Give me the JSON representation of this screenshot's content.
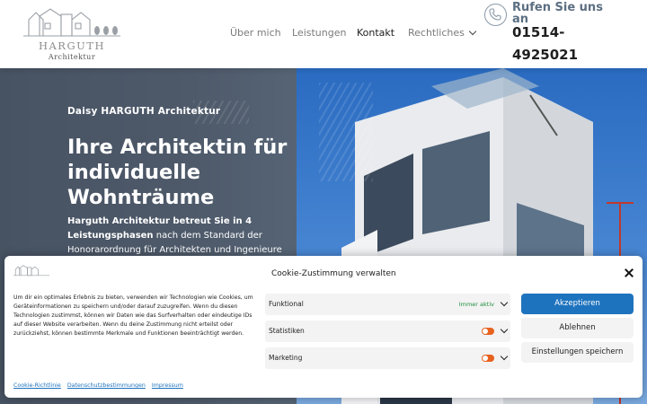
{
  "header": {
    "logo": {
      "name": "HARGUTH",
      "sub": "Architektur"
    },
    "nav": [
      {
        "label": "Über mich",
        "active": false
      },
      {
        "label": "Leistungen",
        "active": false
      },
      {
        "label": "Kontakt",
        "active": true
      },
      {
        "label": "Rechtliches",
        "active": false,
        "dropdown": true
      }
    ],
    "call": {
      "label": "Rufen Sie uns an",
      "number": "01514-4925021",
      "icon": "phone-icon"
    }
  },
  "hero": {
    "kicker": "Daisy HARGUTH Architektur",
    "title": "Ihre Architektin für individuelle Wohnträume",
    "text_bold": "Harguth Architektur betreut Sie in 4 Leistungsphasen",
    "text_rest": " nach dem Standard der Honorarordnung für Architekten und Ingenieure"
  },
  "cookie": {
    "title": "Cookie-Zustimmung verwalten",
    "message": "Um dir ein optimales Erlebnis zu bieten, verwenden wir Technologien wie Cookies, um Geräteinformationen zu speichern und/oder darauf zuzugreifen. Wenn du diesen Technologien zustimmst, können wir Daten wie das Surfverhalten oder eindeutige IDs auf dieser Website verarbeiten. Wenn du deine Zustimmung nicht erteilst oder zurückziehst, können bestimmte Merkmale und Funktionen beeinträchtigt werden.",
    "categories": [
      {
        "label": "Funktional",
        "status": "Immer aktiv"
      },
      {
        "label": "Statistiken",
        "status": ""
      },
      {
        "label": "Marketing",
        "status": ""
      }
    ],
    "buttons": {
      "accept": "Akzeptieren",
      "deny": "Ablehnen",
      "save": "Einstellungen speichern"
    },
    "links": [
      "Cookie-Richtlinie",
      "Datenschutzbestimmungen",
      "Impressum"
    ],
    "colors": {
      "accent": "#1e73be",
      "toggle": "#e8621f",
      "always_active": "#1e8e3e"
    }
  }
}
